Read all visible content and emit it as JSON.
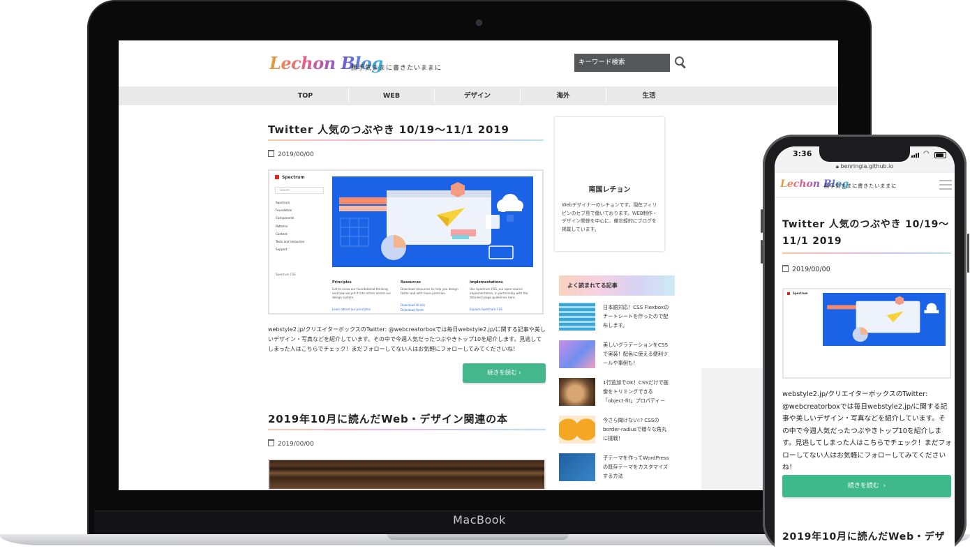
{
  "laptop": {
    "brand": "MacBook"
  },
  "site": {
    "logo": "Lechon Blog",
    "tagline": "勝手気ままに書きたいままに",
    "search_placeholder": "キーワード検索",
    "nav": [
      "TOP",
      "WEB",
      "デザイン",
      "海外",
      "生活"
    ]
  },
  "posts": [
    {
      "title": "Twitter 人気のつぶやき 10/19〜11/1 2019",
      "date": "2019/00/00",
      "excerpt": "webstyle2.jp/クリエイターボックスのTwitter: @webcreatorboxでは毎日webstyle2.jp/に関する記事や美しいデザイン・写真などを紹介しています。その中で今週人気だったつぶやきトップ10を紹介します。見逃してしまった人はこちらでチェック！まだフォローしてない人はお気軽にフォローしてみてくださいね！",
      "read_more": "続きを読む",
      "thumbnail": {
        "brand": "Spectrum",
        "search": "Search",
        "menu": [
          "Spectrum",
          "Foundation",
          "Components",
          "Patterns",
          "Content",
          "Tools and resources",
          "Support"
        ],
        "footer": "Spectrum CSS",
        "columns": [
          {
            "heading": "Principles",
            "text": "Get to know our foundational thinking and how we put it into action across our design system.",
            "links": [
              "Learn about our principles"
            ]
          },
          {
            "heading": "Resources",
            "text": "Download resources to help you design faster and with more precision.",
            "links": [
              "Download UI kits",
              "Download fonts"
            ]
          },
          {
            "heading": "Implementations",
            "text": "Use Spectrum CSS, our open-source implementation, in partnership with the detailed usage guidelines here.",
            "links": [
              "Explore Spectrum CSS"
            ]
          }
        ]
      }
    },
    {
      "title": "2019年10月に読んだWeb・デザイン関連の本",
      "date": "2019/00/00"
    }
  ],
  "sidebar": {
    "profile_name": "南国レチョン",
    "profile_bio": "Webデザイナーのレチョンです。現在フィリピンのセブ島で働いております。WEB制作・デザイン関係を中心に、備忘録的にブログを掲載しています。",
    "popular_heading": "よく読まれてる記事",
    "popular": [
      {
        "text": "日本語対応！CSS Flexboxのチートシートを作ったので配布します。",
        "color": "#3aa6d8"
      },
      {
        "text": "美しいグラデーションをCSSで実装！配色に使える便利ツールや事例も！",
        "color": "#9a7ad8"
      },
      {
        "text": "1行追加でOK！CSSだけで画像をトリミングできる「object-fit」プロパティー",
        "color": "#8a6a4a"
      },
      {
        "text": "今さら聞けない!? CSSのborder-radiusで様々な角丸に挑戦！",
        "color": "#f5a623"
      },
      {
        "text": "子テーマを作ってWordPressの既存テーマをカスタマイズする方法",
        "color": "#2a6aa8"
      }
    ]
  },
  "phone": {
    "time": "3:36",
    "url": "benringia.github.io",
    "tagline": "勝手気ままに書きたいままに",
    "title": "Twitter 人気のつぶやき 10/19〜11/1 2019",
    "date": "2019/00/00",
    "excerpt": "webstyle2.jp/クリエイターボックスのTwitter: @webcreatorboxでは毎日webstyle2.jp/に関する記事や美しいデザイン・写真などを紹介しています。その中で今週人気だったつぶやきトップ10を紹介します。見逃してしまった人はこちらでチェック！まだフォローしてない人はお気軽にフォローしてみてくださいね！",
    "read_more": "続きを読む",
    "next_title": "2019年10月に読んだWeb・デザ"
  },
  "colors": {
    "accent_green": "#45b78f",
    "hero_blue": "#1b63e6",
    "nav_bg": "#e9e9e9",
    "search_bg": "#555657"
  }
}
